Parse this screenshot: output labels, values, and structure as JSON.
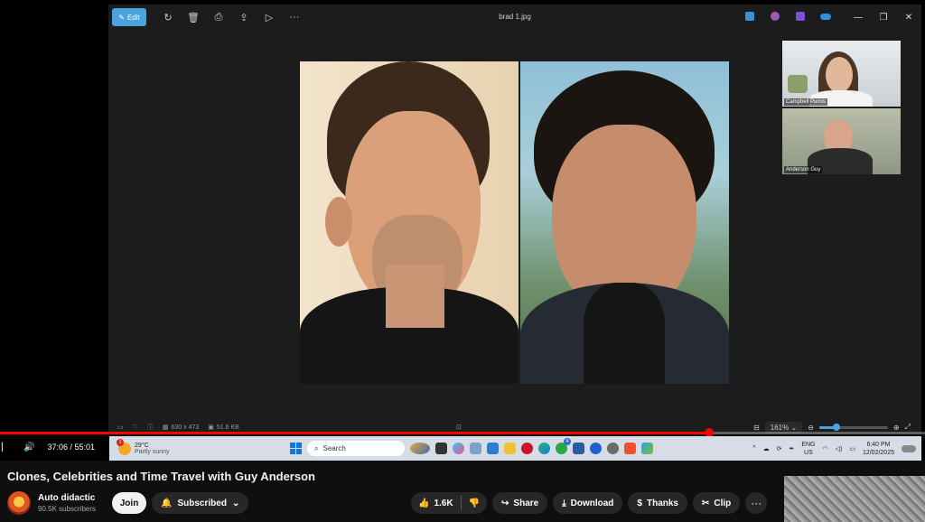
{
  "viewer": {
    "edit_label": "Edit",
    "file_name": "brad 1.jpg",
    "dimensions": "630 x 473",
    "file_size": "51.6 KB",
    "zoom": "161%",
    "zoom_level": 0.25
  },
  "participants": [
    {
      "name": "Campbell Purnis"
    },
    {
      "name": "Anderson Guy"
    }
  ],
  "player": {
    "time": "37:06 / 55:01",
    "progress": 0.767
  },
  "taskbar": {
    "temp": "29°C",
    "condition": "Partly sunny",
    "search_placeholder": "Search",
    "lang": "ENG",
    "region": "US",
    "clock_time": "6:40 PM",
    "clock_date": "12/02/2025",
    "weather_badge": "1",
    "whatsapp_badge": "4"
  },
  "video": {
    "title": "Clones, Celebrities and Time Travel with Guy Anderson",
    "channel": "Auto didactic",
    "subscribers": "90.5K subscribers",
    "join_label": "Join",
    "subscribed_label": "Subscribed",
    "likes": "1.6K",
    "share_label": "Share",
    "download_label": "Download",
    "thanks_label": "Thanks",
    "clip_label": "Clip"
  },
  "colors": {
    "accent": "#4aa3df",
    "progress": "#ff0000"
  }
}
